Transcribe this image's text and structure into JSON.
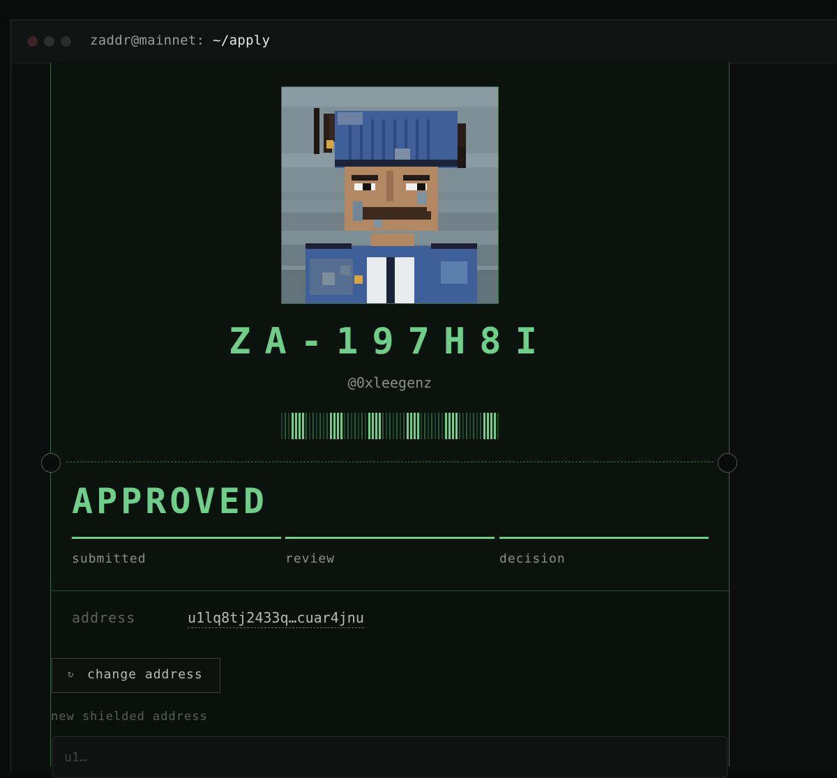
{
  "window": {
    "user_host": "zaddr@mainnet:",
    "path": "~/apply"
  },
  "profile": {
    "code": "ZA-197H8I",
    "handle": "@0xleegenz"
  },
  "application": {
    "status": "APPROVED",
    "steps": [
      {
        "label": "submitted",
        "complete": true
      },
      {
        "label": "review",
        "complete": true
      },
      {
        "label": "decision",
        "complete": true
      }
    ]
  },
  "address": {
    "label": "address",
    "value": "u1lq8tj2433q…cuar4jnu",
    "change_button_label": "change address",
    "new_field_label": "new shielded address",
    "new_field_placeholder": "u1…"
  },
  "colors": {
    "accent": "#6fcf8a",
    "background": "#0a130e",
    "border": "#2f6b45"
  },
  "icons": {
    "change": "refresh-icon"
  }
}
